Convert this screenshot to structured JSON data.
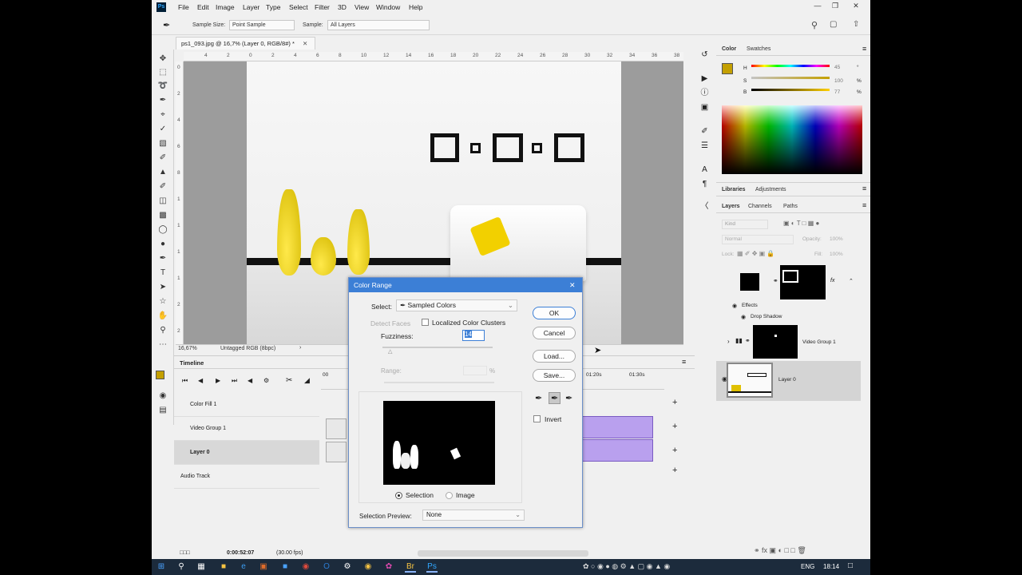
{
  "menu": [
    "File",
    "Edit",
    "Image",
    "Layer",
    "Type",
    "Select",
    "Filter",
    "3D",
    "View",
    "Window",
    "Help"
  ],
  "options": {
    "sample_size_label": "Sample Size:",
    "sample_size_value": "Point Sample",
    "sample_label": "Sample:",
    "sample_value": "All Layers"
  },
  "document": {
    "tab_title": "ps1_093.jpg @ 16,7% (Layer 0, RGB/8#) *",
    "ruler_h": [
      "4",
      "2",
      "0",
      "2",
      "4",
      "6",
      "8",
      "10",
      "12",
      "14",
      "16",
      "18",
      "20",
      "22",
      "24",
      "26",
      "28",
      "30",
      "32",
      "34",
      "36",
      "38"
    ],
    "ruler_v": [
      "0",
      "2",
      "4",
      "6",
      "8",
      "1",
      "1",
      "1",
      "1",
      "2",
      "2"
    ],
    "zoom": "16,67%",
    "profile": "Untagged RGB (8bpc)"
  },
  "timeline": {
    "title": "Timeline",
    "time_markers": [
      "00",
      "01:20s",
      "01:30s"
    ],
    "tracks": [
      "Color Fill 1",
      "Video Group 1",
      "Layer 0",
      "Audio Track"
    ],
    "timecode": "0:00:52:07",
    "fps": "(30.00 fps)"
  },
  "dialog": {
    "title": "Color Range",
    "select_label": "Select:",
    "select_value": "Sampled Colors",
    "detect_faces": "Detect Faces",
    "localized": "Localized Color Clusters",
    "fuzziness_label": "Fuzziness:",
    "fuzziness_value": "14",
    "range_label": "Range:",
    "range_unit": "%",
    "ok": "OK",
    "cancel": "Cancel",
    "load": "Load...",
    "save": "Save...",
    "invert": "Invert",
    "selection_radio": "Selection",
    "image_radio": "Image",
    "preview_label": "Selection Preview:",
    "preview_value": "None"
  },
  "color_panel": {
    "tabs": [
      "Color",
      "Swatches"
    ],
    "h_label": "H",
    "s_label": "S",
    "b_label": "B",
    "h_value": "45",
    "s_value": "100",
    "b_value": "77",
    "unit_deg": "°",
    "unit_pct": "%",
    "foreground": "#c4a000"
  },
  "libraries_panel": {
    "tabs": [
      "Libraries",
      "Adjustments"
    ]
  },
  "layers_panel": {
    "tabs": [
      "Layers",
      "Channels",
      "Paths"
    ],
    "kind_placeholder": "Kind",
    "blend_mode": "Normal",
    "opacity_label": "Opacity:",
    "opacity_value": "100%",
    "lock_label": "Lock:",
    "fill_label": "Fill:",
    "fill_value": "100%",
    "effects_label": "Effects",
    "drop_shadow_label": "Drop Shadow",
    "layer_video_group": "Video Group 1",
    "layer_0": "Layer 0",
    "fx": "fx"
  },
  "taskbar": {
    "language": "ENG",
    "time": "18:14"
  }
}
